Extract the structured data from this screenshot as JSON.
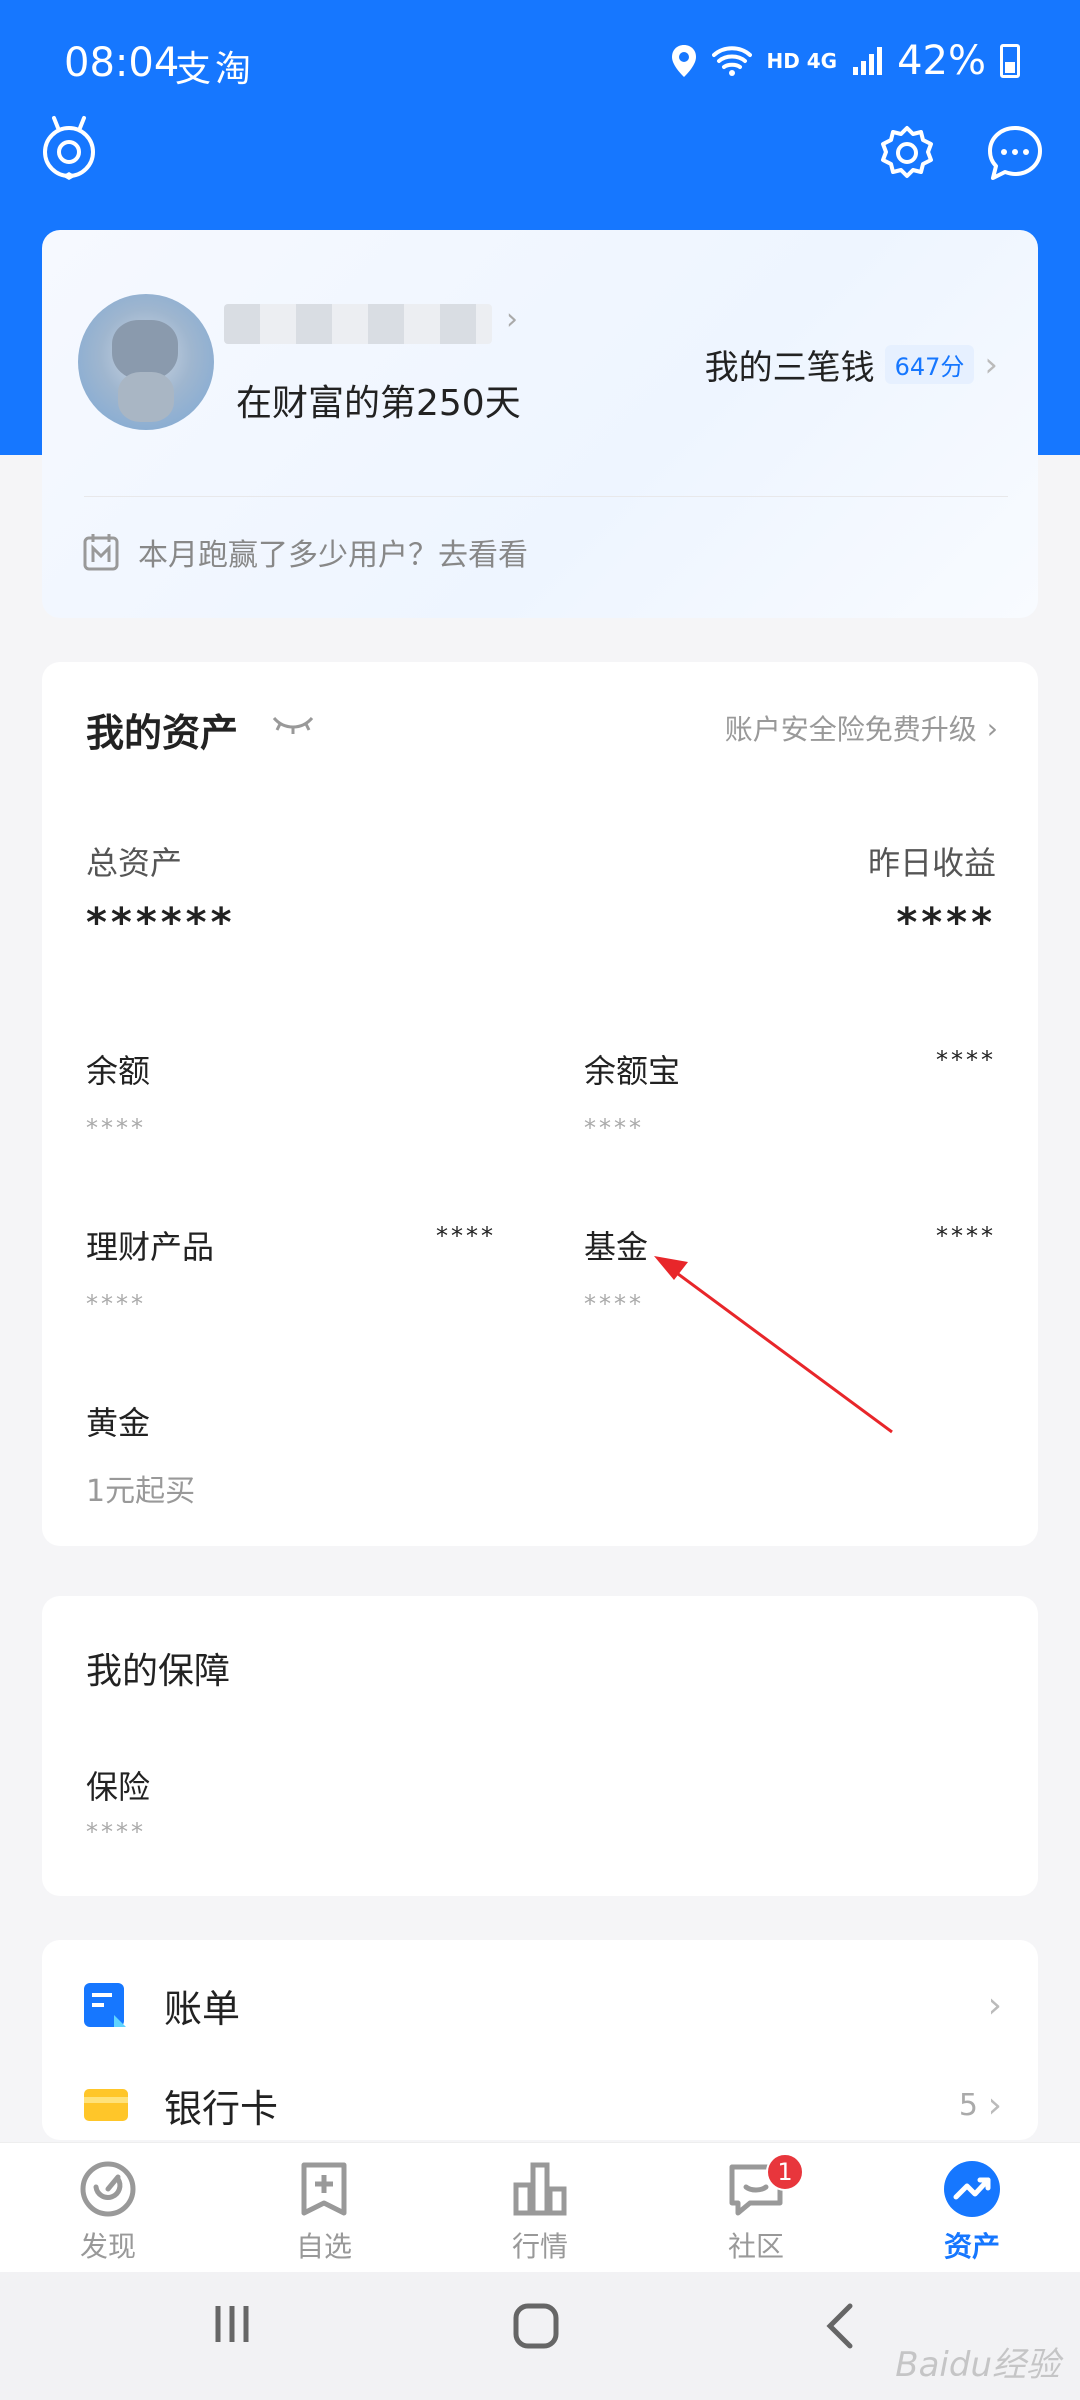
{
  "status_bar": {
    "time": "08:04",
    "app_glyphs": "支淘",
    "network": "HD 4G",
    "battery": "42%"
  },
  "profile": {
    "days_text": "在财富的第250天",
    "three_money_label": "我的三笔钱",
    "score": "647分",
    "monthly_prompt": "本月跑赢了多少用户？去看看"
  },
  "assets": {
    "title": "我的资产",
    "insurance_link": "账户安全险免费升级",
    "total_label": "总资产",
    "total_value": "******",
    "yesterday_label": "昨日收益",
    "yesterday_value": "****",
    "items": [
      {
        "name": "余额",
        "value": "****"
      },
      {
        "name": "余额宝",
        "value": "****",
        "right": "****"
      },
      {
        "name": "理财产品",
        "value": "****",
        "right": "****"
      },
      {
        "name": "基金",
        "value": "****",
        "right": "****"
      },
      {
        "name": "黄金",
        "value": "1元起买"
      }
    ]
  },
  "protection": {
    "title": "我的保障",
    "item_name": "保险",
    "item_value": "****"
  },
  "list": {
    "bill_label": "账单",
    "bank_label": "银行卡",
    "bank_count": "5"
  },
  "tabs": [
    {
      "label": "发现"
    },
    {
      "label": "自选"
    },
    {
      "label": "行情"
    },
    {
      "label": "社区",
      "badge": "1"
    },
    {
      "label": "资产"
    }
  ],
  "watermark": "Baidu经验",
  "colors": {
    "primary": "#1677ff",
    "badge": "#e8363c",
    "annotation_arrow": "#e8262a"
  }
}
